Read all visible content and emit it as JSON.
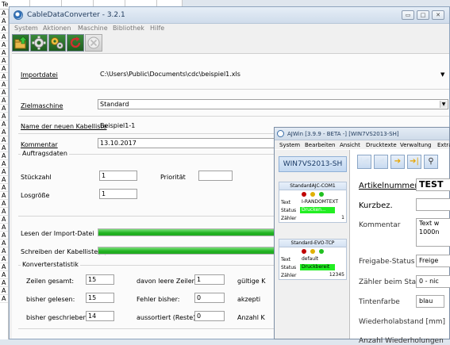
{
  "background_sheet": {
    "col_header": "Te",
    "row_labels": [
      "A",
      "A",
      "A",
      "A",
      "A",
      "A",
      "A",
      "A",
      "A",
      "A",
      "A",
      "A",
      "A",
      "A",
      "A",
      "A",
      "A",
      "A",
      "A",
      "A",
      "A",
      "A",
      "A",
      "A",
      "A",
      "A",
      "A",
      "A",
      "A",
      "A",
      "A",
      "A",
      "A",
      "A",
      "A",
      "A",
      "A"
    ]
  },
  "main_window": {
    "title": "CableDataConverter - 3.2.1",
    "menu": [
      "System",
      "Aktionen",
      "Maschine",
      "Bibliothek",
      "Hilfe"
    ],
    "toolbar_icons": [
      "folder-upload-icon",
      "gear-icon",
      "gears-icon",
      "refresh-icon",
      "close-disabled-icon"
    ],
    "form": {
      "importdatei_label": "Importdatei",
      "importdatei_value": "C:\\Users\\Public\\Documents\\cdc\\beispiel1.xls",
      "zielmaschine_label": "Zielmaschine",
      "zielmaschine_value": "Standard",
      "kabelliste_label": "Name der neuen Kabelliste",
      "kabelliste_value": "Beispiel1-1",
      "kommentar_label": "Kommentar",
      "kommentar_value": "13.10.2017",
      "auftragsdaten_title": "Auftragsdaten",
      "stueckzahl_label": "Stückzahl",
      "stueckzahl_value": "1",
      "prioritaet_label": "Priorität",
      "prioritaet_value": "",
      "losgroesse_label": "Losgröße",
      "losgroesse_value": "1"
    },
    "progress": {
      "lesen_label": "Lesen der Import-Datei",
      "lesen_percent": 100,
      "schreiben_label": "Schreiben der Kabelliste(n)",
      "schreiben_percent": 100
    },
    "stats": {
      "title": "Konverterstatistik",
      "zeilen_gesamt_label": "Zeilen gesamt:",
      "zeilen_gesamt_value": "15",
      "leere_zeilen_label": "davon leere Zeilen:",
      "leere_zeilen_value": "1",
      "gueltige_label": "gültige K",
      "bisher_gelesen_label": "bisher gelesen:",
      "bisher_gelesen_value": "15",
      "fehler_label": "Fehler bisher:",
      "fehler_value": "0",
      "akzeptiert_label": "akzepti",
      "bisher_geschrieben_label": "bisher geschrieben:",
      "bisher_geschrieben_value": "14",
      "aussortiert_label": "aussortiert (Reste):",
      "aussortiert_value": "0",
      "anzahl_label": "Anzahl K"
    }
  },
  "second_window": {
    "title": "AJWin [3.9.9 - BETA -] [WIN7VS2013-SH]",
    "menu": [
      "System",
      "Bearbeiten",
      "Ansicht",
      "Drucktexte",
      "Verwaltung",
      "Extra"
    ],
    "host_button": "WIN7VS2013-SH",
    "devices": [
      {
        "name": "StandardAJC-COM1",
        "text_label": "Text",
        "text_value": "I-RANDOMTEXT",
        "status_label": "Status",
        "status_value": "Drucken...",
        "zaehler_label": "Zähler",
        "zaehler_value": "1",
        "lights": [
          "#c00000",
          "#e0b000",
          "#20c020"
        ]
      },
      {
        "name": "Standard-EVO-TCP",
        "text_label": "Text",
        "text_value": "default",
        "status_label": "Status",
        "status_value": "Druckbereit",
        "zaehler_label": "Zähler",
        "zaehler_value": "12345",
        "lights": [
          "#c00000",
          "#e0b000",
          "#20c020"
        ]
      }
    ],
    "fields": {
      "artikelnummer_label": "Artikelnummer",
      "artikelnummer_value": "TEST",
      "kurzbez_label": "Kurzbez.",
      "kurzbez_value": "",
      "kommentar_label": "Kommentar",
      "kommentar_value_line1": "Text w",
      "kommentar_value_line2": "1000n",
      "freigabe_label": "Freigabe-Status",
      "freigabe_value": "Freige",
      "zaehler_start_label": "Zähler beim Start",
      "zaehler_start_value": "0 - nic",
      "tintenfarbe_label": "Tintenfarbe",
      "tintenfarbe_value": "blau",
      "wiederhol_label": "Wiederholabstand [mm]",
      "anzahl_label": "Anzahl Wiederholungen"
    }
  }
}
